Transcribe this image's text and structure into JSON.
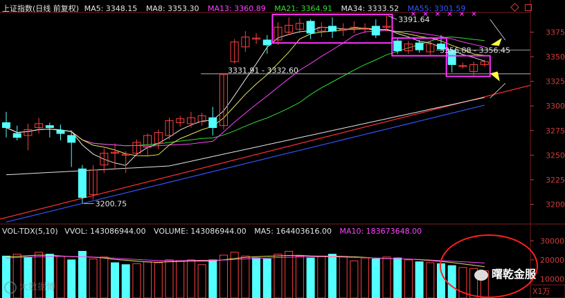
{
  "header": {
    "title": "上证指数(日线 前复权)",
    "ma": [
      {
        "label": "MA5: 3348.15",
        "color": "#e6e6e6"
      },
      {
        "label": "MA8: 3353.30",
        "color": "#e6e6e6"
      },
      {
        "label": "MA13: 3360.89",
        "color": "#ff44ff"
      },
      {
        "label": "MA21: 3364.91",
        "color": "#33dd33"
      },
      {
        "label": "MA34: 3333.52",
        "color": "#e6e6e6"
      },
      {
        "label": "MA55: 3301.59",
        "color": "#3355ff"
      }
    ]
  },
  "volume_header": {
    "items": [
      {
        "label": "VOL-TDX(5,10)",
        "color": "#e6e6e6"
      },
      {
        "label": "VVOL: 143086944.00",
        "color": "#e6e6e6"
      },
      {
        "label": "VOLUME: 143086944.00",
        "color": "#e6e6e6"
      },
      {
        "label": "MA5: 164403616.00",
        "color": "#e6e6e6"
      },
      {
        "label": "MA10: 183673648.00",
        "color": "#ff44ff"
      }
    ]
  },
  "annotations": {
    "high": "3391.64",
    "low": "3200.75",
    "mid": "3331.91 - 3332.60",
    "right": "3356.88 - 3356.45"
  },
  "watermark_left": "大数据博",
  "watermark_right": "曙乾金服",
  "unit_label": "X1万",
  "colors": {
    "up": "#ff4040",
    "down": "#54ffff",
    "box": "#ff33ff",
    "grid": "#7a1c1c",
    "ma5": "#e6e6e6",
    "ma8": "#e8e85a",
    "ma13": "#ff44ff",
    "ma21": "#33dd33",
    "ma34": "#e6e6e6",
    "ma55": "#3355ff",
    "trend_red": "#ff3030",
    "arrow": "#ffff44"
  },
  "chart_data": {
    "type": "candlestick",
    "price_axis": {
      "ylim": [
        3180,
        3395
      ],
      "ticks": [
        3200,
        3225,
        3250,
        3275,
        3300,
        3325,
        3350,
        3375
      ]
    },
    "volume_axis": {
      "unit": "X1万",
      "ylim": [
        0,
        33000
      ],
      "ticks": [
        10000,
        20000,
        30000
      ]
    },
    "candles": [
      [
        3283,
        3278,
        3294,
        3268
      ],
      [
        3272,
        3268,
        3280,
        3265
      ],
      [
        3270,
        3276,
        3282,
        3255
      ],
      [
        3278,
        3282,
        3288,
        3272
      ],
      [
        3280,
        3278,
        3283,
        3268
      ],
      [
        3275,
        3272,
        3281,
        3265
      ],
      [
        3270,
        3263,
        3275,
        3238
      ],
      [
        3236,
        3207,
        3240,
        3200.75
      ],
      [
        3210,
        3235,
        3240,
        3205
      ],
      [
        3240,
        3252,
        3257,
        3232
      ],
      [
        3252,
        3253,
        3262,
        3236
      ],
      [
        3250,
        3251,
        3254,
        3232
      ],
      [
        3252,
        3263,
        3266,
        3249
      ],
      [
        3258,
        3270,
        3272,
        3250
      ],
      [
        3262,
        3273,
        3276,
        3256
      ],
      [
        3270,
        3285,
        3288,
        3266
      ],
      [
        3283,
        3287,
        3290,
        3279
      ],
      [
        3282,
        3288,
        3294,
        3278
      ],
      [
        3284,
        3290,
        3293,
        3280
      ],
      [
        3288,
        3278,
        3299,
        3270
      ],
      [
        3280,
        3331.91,
        3332.6,
        3276
      ],
      [
        3345,
        3365,
        3368,
        3343
      ],
      [
        3360,
        3370,
        3376,
        3355
      ],
      [
        3368,
        3369,
        3374,
        3363
      ],
      [
        3367,
        3362,
        3372,
        3353
      ],
      [
        3367,
        3380,
        3385,
        3362
      ],
      [
        3375,
        3382,
        3390,
        3372
      ],
      [
        3378,
        3384,
        3389,
        3374
      ],
      [
        3386,
        3374,
        3388,
        3368
      ],
      [
        3376,
        3380,
        3385,
        3370
      ],
      [
        3381,
        3376,
        3390,
        3369
      ],
      [
        3377,
        3378,
        3384,
        3371
      ],
      [
        3378,
        3380,
        3386,
        3374
      ],
      [
        3378,
        3379,
        3384,
        3374
      ],
      [
        3381,
        3372,
        3388,
        3369
      ],
      [
        3380,
        3381,
        3391.64,
        3376
      ],
      [
        3366,
        3356,
        3369,
        3353
      ],
      [
        3356,
        3363,
        3366,
        3353
      ],
      [
        3364,
        3357,
        3367,
        3354
      ],
      [
        3355,
        3363,
        3366,
        3352
      ],
      [
        3363,
        3358,
        3372,
        3356
      ],
      [
        3356,
        3342,
        3357,
        3334
      ],
      [
        3341,
        3341,
        3344,
        3338
      ],
      [
        3335,
        3342,
        3345,
        3331
      ],
      [
        3342,
        3345,
        3347,
        3340
      ]
    ],
    "volume": [
      [
        22000,
        0
      ],
      [
        23000,
        1
      ],
      [
        21500,
        0
      ],
      [
        24000,
        1
      ],
      [
        23000,
        0
      ],
      [
        22000,
        1
      ],
      [
        20000,
        0
      ],
      [
        24500,
        0
      ],
      [
        20500,
        1
      ],
      [
        21500,
        1
      ],
      [
        18500,
        0
      ],
      [
        17500,
        0
      ],
      [
        18000,
        1
      ],
      [
        19000,
        1
      ],
      [
        18500,
        1
      ],
      [
        20000,
        1
      ],
      [
        19500,
        1
      ],
      [
        20000,
        1
      ],
      [
        17500,
        1
      ],
      [
        20000,
        0
      ],
      [
        22500,
        1
      ],
      [
        24000,
        1
      ],
      [
        22000,
        1
      ],
      [
        21000,
        0
      ],
      [
        20500,
        0
      ],
      [
        23000,
        1
      ],
      [
        24500,
        1
      ],
      [
        22000,
        1
      ],
      [
        21000,
        0
      ],
      [
        22000,
        1
      ],
      [
        23000,
        0
      ],
      [
        21500,
        1
      ],
      [
        19500,
        1
      ],
      [
        21000,
        1
      ],
      [
        20500,
        0
      ],
      [
        21500,
        1
      ],
      [
        21000,
        0
      ],
      [
        20000,
        1
      ],
      [
        19000,
        0
      ],
      [
        18500,
        1
      ],
      [
        18000,
        0
      ],
      [
        17000,
        0
      ],
      [
        16000,
        1
      ],
      [
        15500,
        1
      ],
      [
        14308.6944,
        1
      ]
    ],
    "volume_ma5": [
      21500,
      21800,
      22200,
      22500,
      22400,
      22000,
      21700,
      21600,
      21400,
      21000,
      20200,
      19800,
      19300,
      18900,
      18800,
      19000,
      19200,
      19400,
      19400,
      19400,
      20000,
      20700,
      21300,
      21700,
      21900,
      22100,
      22300,
      22400,
      22100,
      21900,
      22000,
      21800,
      21600,
      21300,
      20900,
      20700,
      20600,
      20400,
      20100,
      19700,
      19200,
      18600,
      17900,
      17200,
      16440.3616
    ],
    "volume_ma10": [
      21000,
      21200,
      21400,
      21600,
      21800,
      21900,
      21800,
      21700,
      21500,
      21200,
      20900,
      20500,
      20200,
      19900,
      19700,
      19600,
      19600,
      19700,
      19800,
      19800,
      19900,
      20200,
      20500,
      20800,
      21000,
      21200,
      21400,
      21600,
      21700,
      21700,
      21600,
      21500,
      21300,
      21200,
      21000,
      20800,
      20600,
      20400,
      20200,
      19900,
      19600,
      19300,
      19000,
      18700,
      18367.3648
    ]
  }
}
